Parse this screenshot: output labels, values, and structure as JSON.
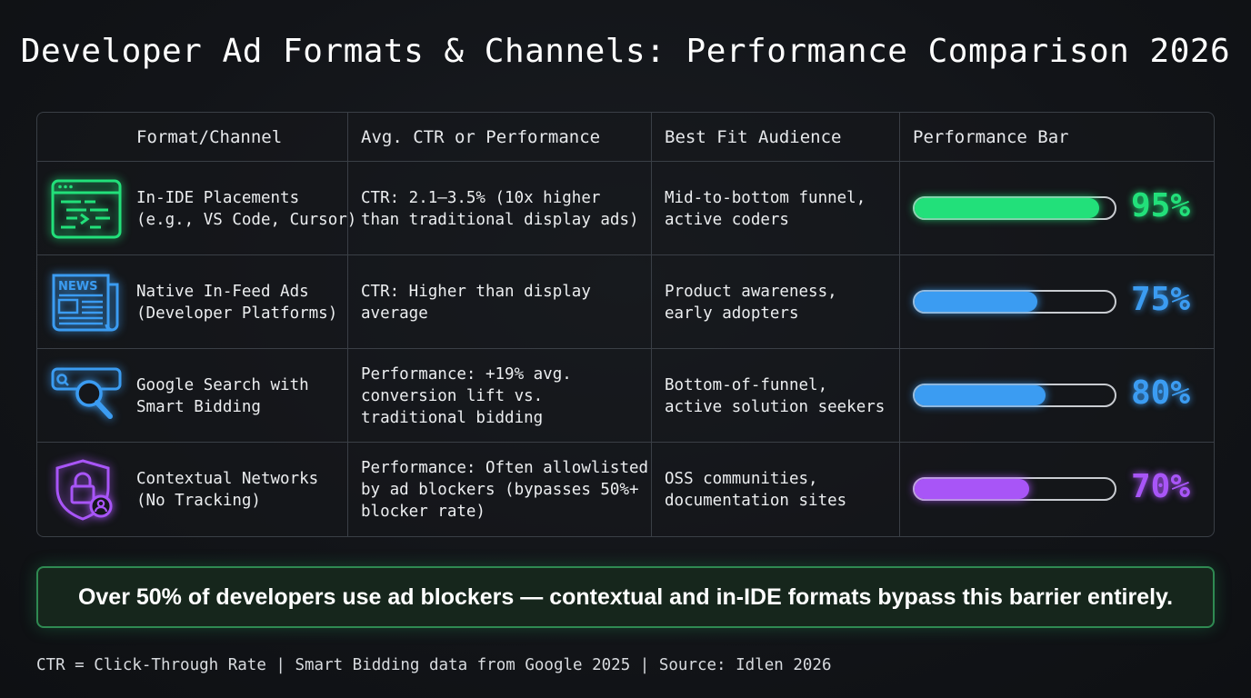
{
  "title": "Developer Ad Formats & Channels: Performance Comparison 2026",
  "headers": [
    "Format/Channel",
    "Avg. CTR or Performance",
    "Best Fit Audience",
    "Performance Bar"
  ],
  "rows": [
    {
      "icon": "code-editor-icon",
      "format": "In-IDE Placements\n(e.g., VS Code, Cursor)",
      "performance": "CTR: 2.1–3.5% (10x higher\nthan traditional display ads)",
      "audience": "Mid-to-bottom funnel,\nactive coders",
      "percent_label": "95%",
      "color": "#22e07a"
    },
    {
      "icon": "newspaper-icon",
      "format": "Native In-Feed Ads\n(Developer Platforms)",
      "performance": "CTR: Higher than display\naverage",
      "audience": "Product awareness,\nearly adopters",
      "percent_label": "75%",
      "color": "#3b9cf2"
    },
    {
      "icon": "search-magnifier-icon",
      "format": "Google Search with\nSmart Bidding",
      "performance": "Performance: +19% avg.\nconversion lift vs.\ntraditional bidding",
      "audience": "Bottom-of-funnel,\nactive solution seekers",
      "percent_label": "80%",
      "color": "#3b9cf2"
    },
    {
      "icon": "privacy-shield-lock-icon",
      "format": "Contextual Networks\n(No Tracking)",
      "performance": "Performance: Often allowlisted\nby ad blockers (bypasses 50%+\nblocker rate)",
      "audience": "OSS communities,\ndocumentation sites",
      "percent_label": "70%",
      "color": "#a855f7"
    }
  ],
  "callout": "Over 50% of developers use ad blockers — contextual and in-IDE formats bypass this barrier entirely.",
  "footnote": "CTR = Click-Through Rate | Smart Bidding data from Google 2025 | Source: Idlen 2026",
  "chart_data": {
    "type": "bar",
    "categories": [
      "In-IDE Placements",
      "Native In-Feed Ads",
      "Google Search with Smart Bidding",
      "Contextual Networks"
    ],
    "values": [
      95,
      75,
      80,
      70
    ],
    "ylim": [
      0,
      100
    ],
    "colors": [
      "#22e07a",
      "#3b9cf2",
      "#3b9cf2",
      "#a855f7"
    ]
  }
}
